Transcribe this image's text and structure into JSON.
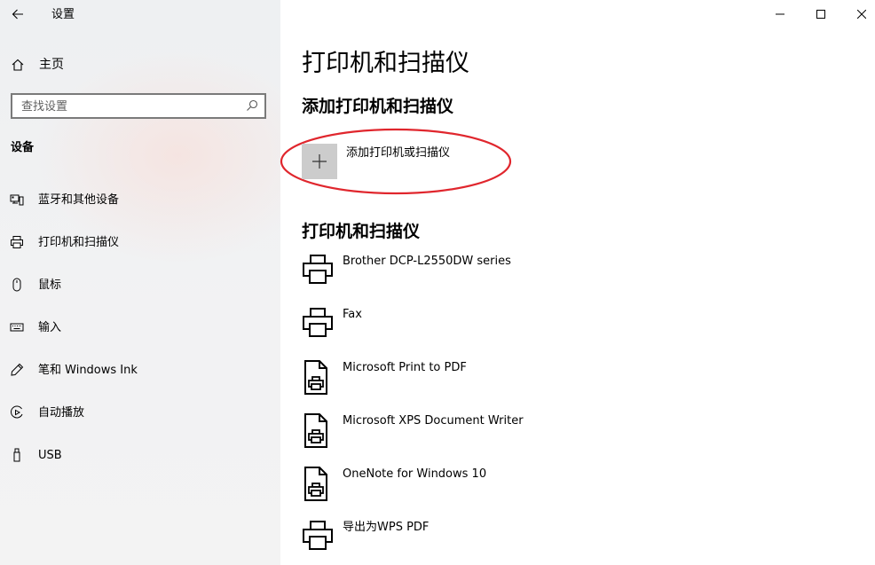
{
  "window": {
    "title": "设置"
  },
  "sidebar": {
    "home_label": "主页",
    "search_placeholder": "查找设置",
    "section_title": "设备",
    "items": [
      {
        "label": "蓝牙和其他设备",
        "icon": "bluetooth-devices-icon"
      },
      {
        "label": "打印机和扫描仪",
        "icon": "printer-icon"
      },
      {
        "label": "鼠标",
        "icon": "mouse-icon"
      },
      {
        "label": "输入",
        "icon": "keyboard-icon"
      },
      {
        "label": "笔和 Windows Ink",
        "icon": "pen-icon"
      },
      {
        "label": "自动播放",
        "icon": "autoplay-icon"
      },
      {
        "label": "USB",
        "icon": "usb-icon"
      }
    ]
  },
  "main": {
    "page_title": "打印机和扫描仪",
    "add_section_title": "添加打印机和扫描仪",
    "add_button_label": "添加打印机或扫描仪",
    "list_title": "打印机和扫描仪",
    "devices": [
      {
        "name": "Brother DCP-L2550DW series",
        "icon": "printer-icon"
      },
      {
        "name": "Fax",
        "icon": "printer-icon"
      },
      {
        "name": "Microsoft Print to PDF",
        "icon": "document-printer-icon"
      },
      {
        "name": "Microsoft XPS Document Writer",
        "icon": "document-printer-icon"
      },
      {
        "name": "OneNote for Windows 10",
        "icon": "document-printer-icon"
      },
      {
        "name": "导出为WPS PDF",
        "icon": "printer-icon"
      }
    ]
  },
  "colors": {
    "annotation": "#e0262d",
    "add_tile": "#cccccc",
    "sidebar_bg": "#f2f2f2"
  }
}
